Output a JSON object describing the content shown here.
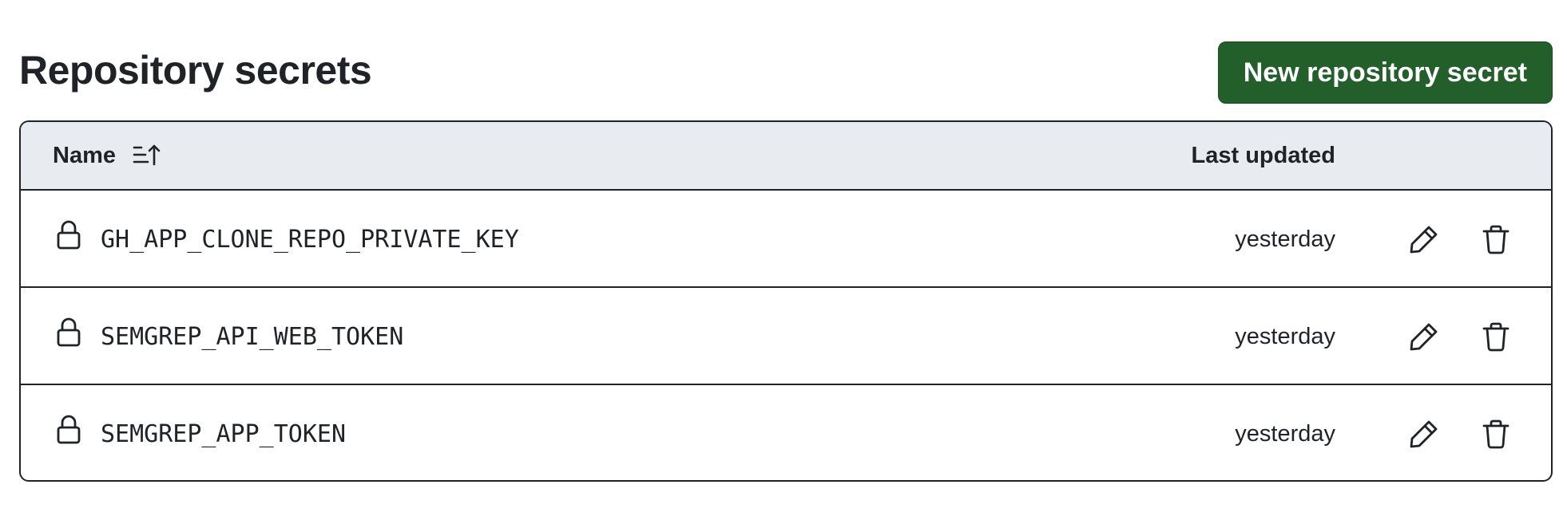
{
  "page": {
    "title": "Repository secrets"
  },
  "toolbar": {
    "new_secret_label": "New repository secret"
  },
  "table": {
    "columns": {
      "name": "Name",
      "last_updated": "Last updated"
    },
    "sort": {
      "column": "name",
      "direction": "ascending",
      "icon": "sort-ascending-icon"
    },
    "rows": [
      {
        "name": "GH_APP_CLONE_REPO_PRIVATE_KEY",
        "last_updated": "yesterday"
      },
      {
        "name": "SEMGREP_API_WEB_TOKEN",
        "last_updated": "yesterday"
      },
      {
        "name": "SEMGREP_APP_TOKEN",
        "last_updated": "yesterday"
      }
    ],
    "row_icons": {
      "leading": "lock-icon",
      "edit": "pencil-icon",
      "delete": "trash-icon"
    }
  },
  "colors": {
    "primary_button": "#235f2a",
    "header_background": "#e8ebef",
    "text": "#1f2328",
    "border": "#1f2328"
  }
}
